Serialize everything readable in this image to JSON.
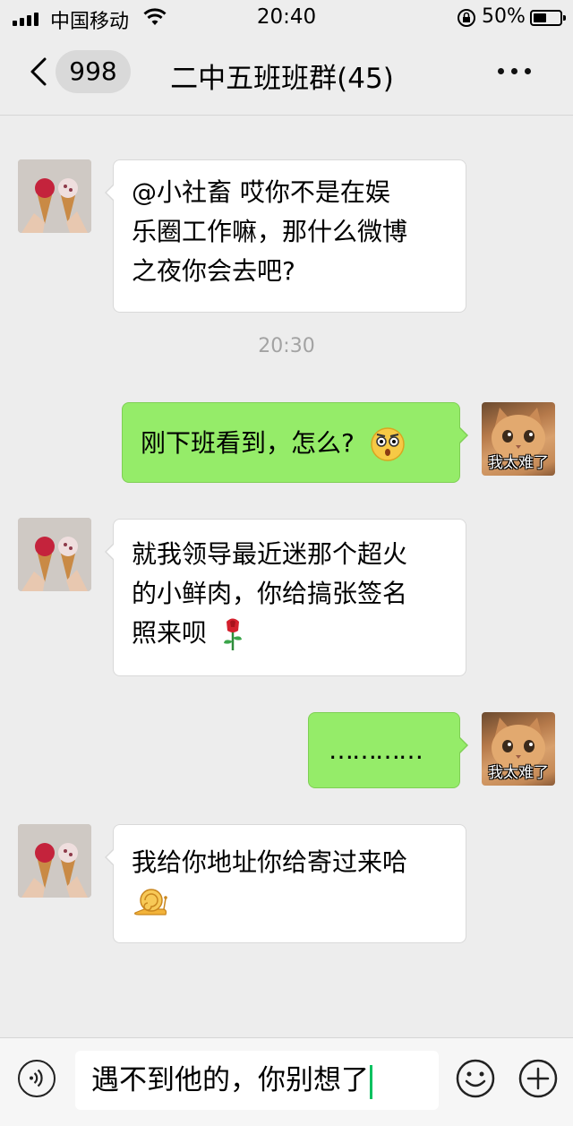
{
  "status_bar": {
    "carrier": "中国移动",
    "time": "20:40",
    "battery_percent": "50%",
    "battery_level": 0.5
  },
  "header": {
    "unread_count": "998",
    "chat_title": "二中五班班群(45)"
  },
  "messages": [
    {
      "side": "left",
      "avatar": "ice-cream-avatar",
      "text_lines": [
        "@小社畜 哎你不是在娱",
        "乐圈工作嘛，那什么微博",
        "之夜你会去吧?"
      ]
    },
    {
      "side": "center",
      "timestamp": "20:30"
    },
    {
      "side": "right",
      "avatar": "cat-avatar",
      "avatar_caption": "我太难了",
      "text": "刚下班看到，怎么?",
      "emoji": "shocked-face-emoji"
    },
    {
      "side": "left",
      "avatar": "ice-cream-avatar",
      "text_lines": [
        "就我领导最近迷那个超火",
        "的小鲜肉，你给搞张签名",
        "照来呗"
      ],
      "emoji": "rose-emoji"
    },
    {
      "side": "right",
      "avatar": "cat-avatar",
      "avatar_caption": "我太难了",
      "text": "…………"
    },
    {
      "side": "left",
      "avatar": "ice-cream-avatar",
      "text_lines": [
        "我给你地址你给寄过来哈"
      ],
      "emoji": "snail-emoji"
    }
  ],
  "input_bar": {
    "draft_text": "遇不到他的，你别想了",
    "icons": [
      "voice-icon",
      "emoji-icon",
      "plus-icon"
    ]
  },
  "colors": {
    "background": "#ededed",
    "bubble_self": "#95ec69",
    "bubble_other": "#ffffff",
    "caret": "#07c160"
  }
}
